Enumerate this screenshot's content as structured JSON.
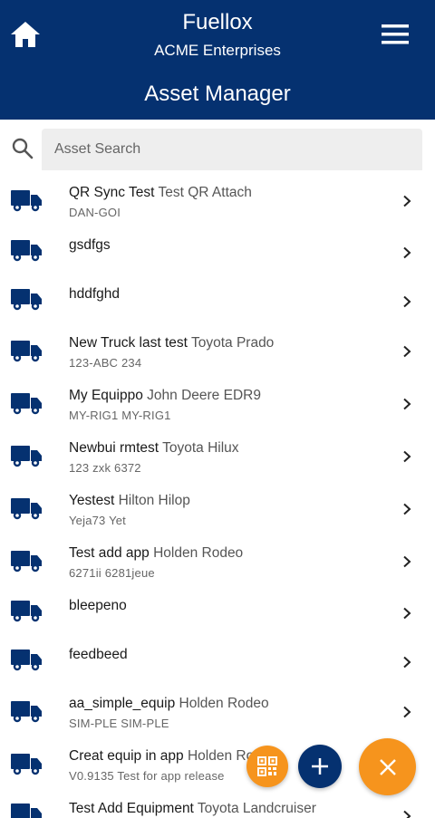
{
  "header": {
    "app_name": "Fuellox",
    "org_name": "ACME Enterprises",
    "page_title": "Asset Manager"
  },
  "search": {
    "placeholder": "Asset Search",
    "value": ""
  },
  "colors": {
    "brand_navy": "#053170",
    "accent_orange": "#f6941d",
    "icon_truck": "#053170"
  },
  "icons": {
    "home": "home-icon",
    "menu": "hamburger-menu-icon",
    "search": "search-icon",
    "row": "truck-icon",
    "row_action": "chevron-right-icon",
    "fab_qr": "qr-code-icon",
    "fab_add": "plus-icon",
    "fab_close": "close-icon"
  },
  "assets": [
    {
      "name": "QR Sync Test",
      "model": "Test QR Attach",
      "ids": "DAN-GOI"
    },
    {
      "name": "gsdfgs",
      "model": "",
      "ids": ""
    },
    {
      "name": "hddfghd",
      "model": "",
      "ids": ""
    },
    {
      "name": "New Truck last test",
      "model": "Toyota Prado",
      "ids": "123-ABC 234"
    },
    {
      "name": "My Equippo",
      "model": "John Deere EDR9",
      "ids": "MY-RIG1 MY-RIG1"
    },
    {
      "name": "Newbui rmtest",
      "model": "Toyota Hilux",
      "ids": "123 zxk 6372"
    },
    {
      "name": "Yestest",
      "model": "Hilton Hilop",
      "ids": "Yeja73 Yet"
    },
    {
      "name": "Test add app",
      "model": "Holden Rodeo",
      "ids": "6271ii 6281jeue"
    },
    {
      "name": "bleepeno",
      "model": "",
      "ids": ""
    },
    {
      "name": "feedbeed",
      "model": "",
      "ids": ""
    },
    {
      "name": "aa_simple_equip",
      "model": "Holden Rodeo",
      "ids": "SIM-PLE SIM-PLE"
    },
    {
      "name": "Creat equip in app",
      "model": "Holden Rodeo",
      "ids": "V0.9135 Test for app release"
    },
    {
      "name": "Test Add Equipment",
      "model": "Toyota Landcruiser",
      "ids": ""
    }
  ]
}
